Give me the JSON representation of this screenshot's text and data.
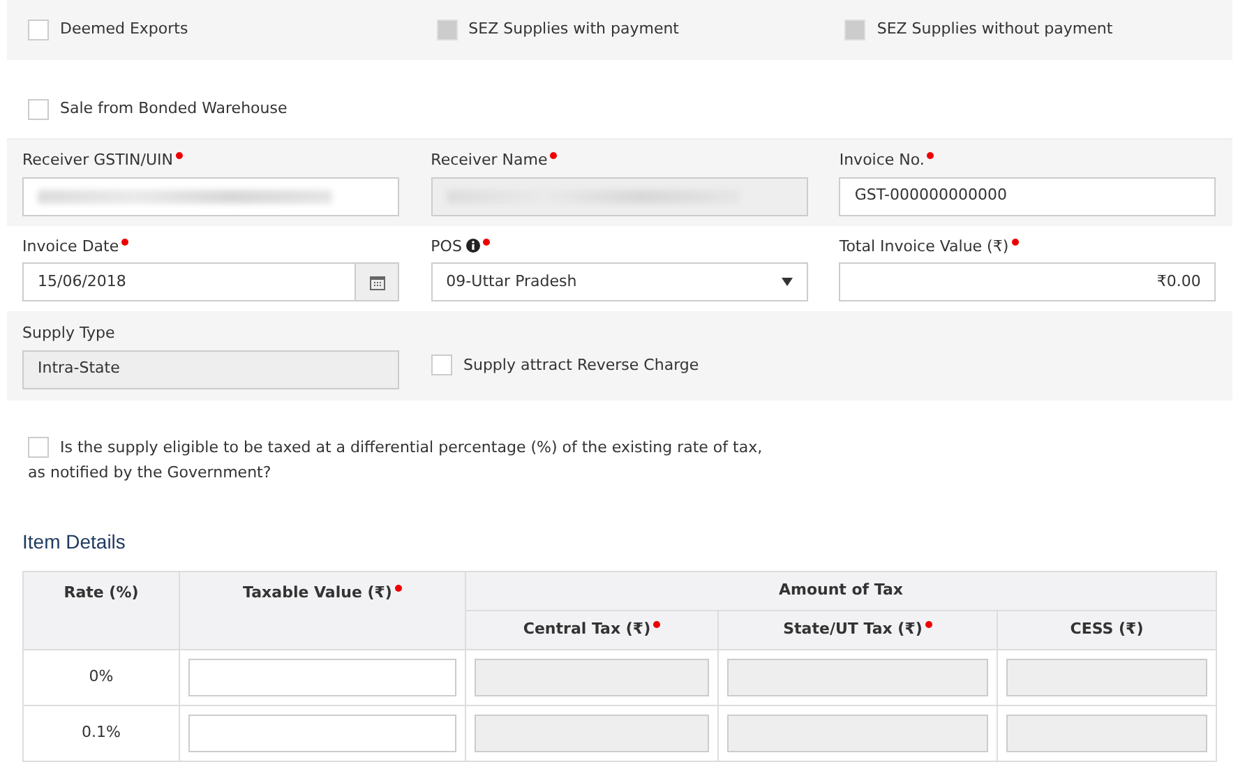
{
  "supply_options": [
    {
      "label": "Deemed Exports",
      "checked": false,
      "disabled": false
    },
    {
      "label": "SEZ Supplies with payment",
      "checked": false,
      "disabled": true
    },
    {
      "label": "SEZ Supplies without payment",
      "checked": false,
      "disabled": true
    }
  ],
  "bonded_option": {
    "label": "Sale from Bonded Warehouse",
    "checked": false,
    "disabled": false
  },
  "form_rows": [
    {
      "fields": [
        {
          "kind": "text",
          "label": "Receiver GSTIN/UIN",
          "required": true,
          "redacted": true,
          "disabled": false
        },
        {
          "kind": "text",
          "label": "Receiver Name",
          "required": true,
          "redacted": true,
          "disabled": true
        },
        {
          "kind": "text",
          "label": "Invoice No.",
          "required": true,
          "value": "GST-000000000000",
          "disabled": false
        }
      ]
    },
    {
      "fields": [
        {
          "kind": "date",
          "label": "Invoice Date",
          "required": true,
          "value": "15/06/2018",
          "disabled": false
        },
        {
          "kind": "select",
          "label": "POS",
          "required": true,
          "info": true,
          "value": "09-Uttar Pradesh",
          "disabled": false
        },
        {
          "kind": "amount",
          "label": "Total Invoice Value (₹)",
          "required": true,
          "value": "₹0.00",
          "disabled": false
        }
      ]
    },
    {
      "fields": [
        {
          "kind": "text",
          "label": "Supply Type",
          "required": false,
          "value": "Intra-State",
          "disabled": true
        },
        {
          "kind": "checkbox",
          "label": "Supply attract Reverse Charge",
          "checked": false,
          "disabled": false
        }
      ]
    }
  ],
  "differential_option": {
    "label": "Is the supply eligible to be taxed at a differential percentage (%) of the existing rate of tax,",
    "label_line_2": "as notified by the Government?",
    "checked": false,
    "disabled": false
  },
  "item_details": {
    "title": "Item Details",
    "columns": {
      "rate": {
        "label": "Rate (%)",
        "required": false
      },
      "taxable": {
        "label": "Taxable Value (₹)",
        "required": true
      },
      "group": "Amount of Tax",
      "sub": [
        {
          "label": "Central Tax (₹)",
          "required": true
        },
        {
          "label": "State/UT Tax (₹)",
          "required": true
        },
        {
          "label": "CESS (₹)",
          "required": false
        }
      ]
    },
    "rows": [
      {
        "rate": "0%"
      },
      {
        "rate": "0.1%"
      }
    ]
  }
}
